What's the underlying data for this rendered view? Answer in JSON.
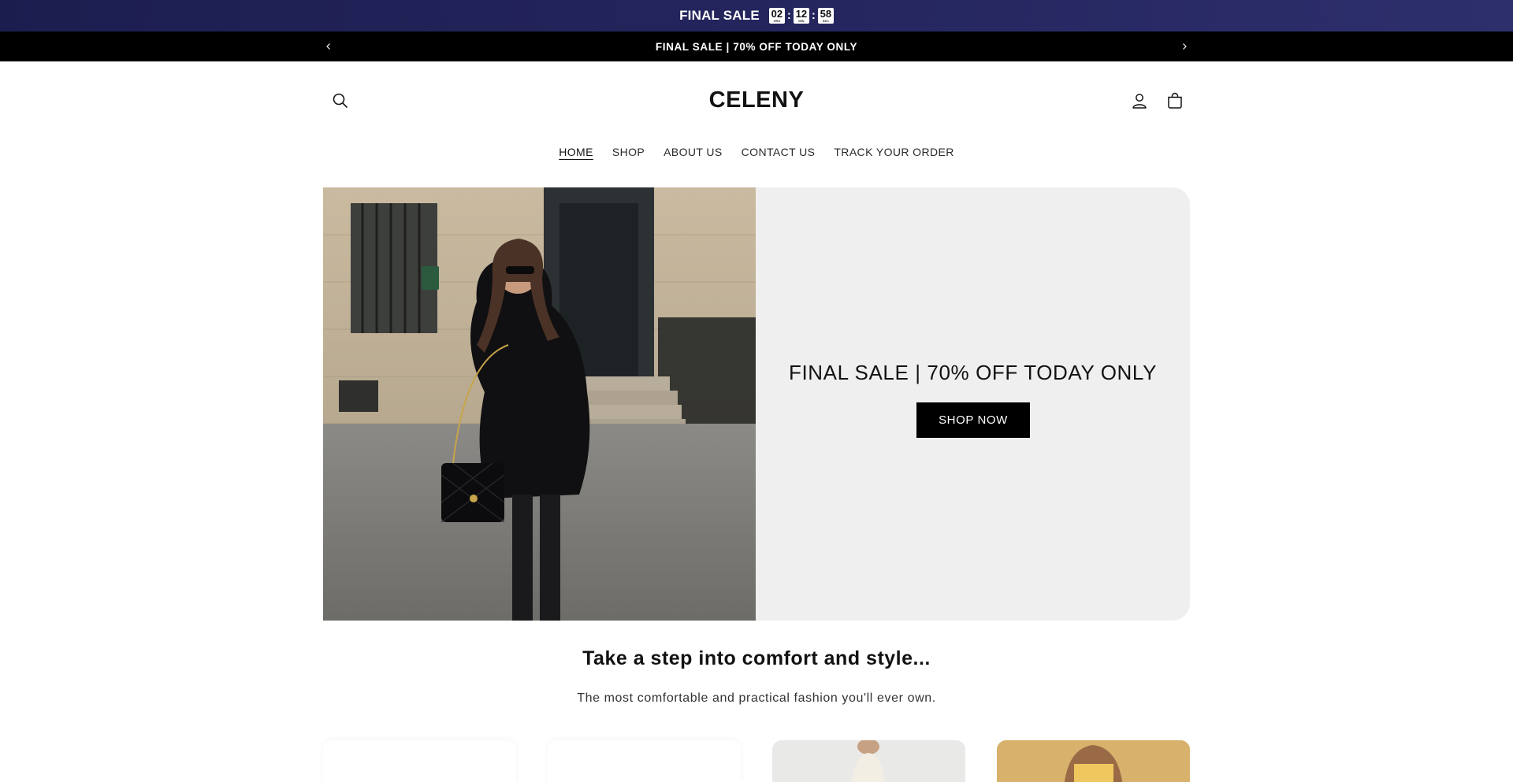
{
  "countdown": {
    "title": "FINAL SALE",
    "hours": "02",
    "minutes": "12",
    "seconds": "58",
    "hours_unit": "HRS",
    "minutes_unit": "MIN",
    "seconds_unit": "SEC",
    "separator": ":"
  },
  "announcement": {
    "text": "FINAL SALE | 70% OFF TODAY ONLY"
  },
  "header": {
    "logo": "CELENY"
  },
  "nav": {
    "items": [
      {
        "label": "HOME",
        "active": true
      },
      {
        "label": "SHOP"
      },
      {
        "label": "ABOUT US"
      },
      {
        "label": "CONTACT US"
      },
      {
        "label": "TRACK YOUR ORDER"
      }
    ]
  },
  "hero": {
    "heading": "FINAL SALE | 70% OFF TODAY ONLY",
    "button": "SHOP NOW"
  },
  "section": {
    "title": "Take a step into comfort and style...",
    "subtitle": "The most comfortable and practical fashion you'll ever own."
  },
  "colors": {
    "countdown_bg": "#24255d",
    "announcement_bg": "#000000",
    "hero_panel_bg": "#efefef",
    "button_bg": "#000000"
  }
}
